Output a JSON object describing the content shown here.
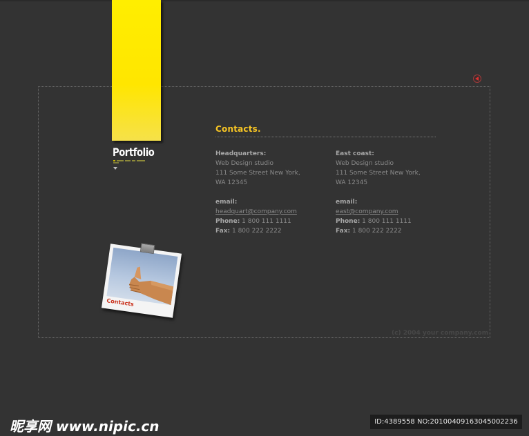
{
  "brand": {
    "logo_text": "Portfolio"
  },
  "nav": {
    "back_button_label": "◄"
  },
  "contacts": {
    "title": "Contacts.",
    "headquarters": {
      "heading": "Headquarters:",
      "line1": "Web Design studio",
      "line2": "111 Some Street New York,",
      "line3": "WA 12345",
      "email_label": "email:",
      "email": "headquart@company.com",
      "phone_label": "Phone:",
      "phone": "1 800 111 1111",
      "fax_label": "Fax:",
      "fax": "1 800 222 2222"
    },
    "east": {
      "heading": "East coast:",
      "line1": "Web Design studio",
      "line2": "111 Some Street New York,",
      "line3": "WA 12345",
      "email_label": "email:",
      "email": "east@company.com",
      "phone_label": "Phone:",
      "phone": "1 800 111 1111",
      "fax_label": "Fax:",
      "fax": "1 800 222 2222"
    }
  },
  "photo": {
    "label": "Contacts"
  },
  "footer": {
    "copyright": "(c) 2004 your company.com"
  },
  "watermark": {
    "site": "昵享网 www.nipic.cn",
    "id_text": "ID:4389558 NO:20100409163045002236"
  },
  "colors": {
    "background": "#333333",
    "accent_yellow": "#ffee00",
    "title_gold": "#f7c524",
    "text_gray": "#8a8a8a",
    "label_red": "#c9301a"
  }
}
